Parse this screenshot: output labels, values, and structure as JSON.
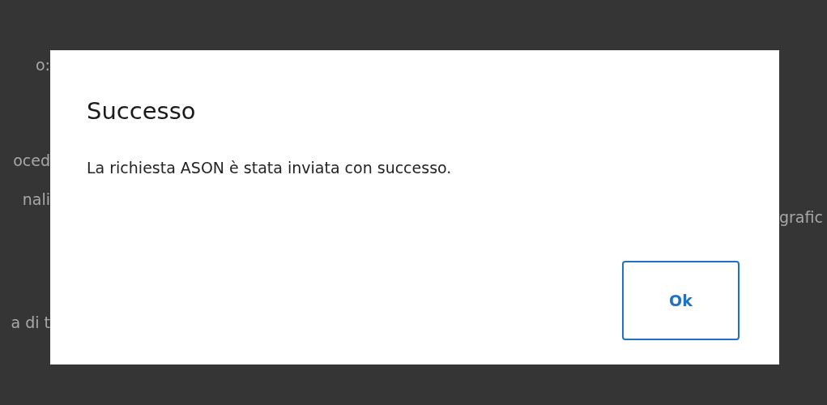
{
  "background_page": {
    "left_fragments": [
      "o:",
      "oced",
      "nali",
      "a di t"
    ],
    "right_fragment": "grafic"
  },
  "dialog": {
    "title": "Successo",
    "message": "La richiesta ASON è stata inviata con successo.",
    "buttons": [
      {
        "label": "Ok",
        "kind": "outline"
      }
    ]
  }
}
